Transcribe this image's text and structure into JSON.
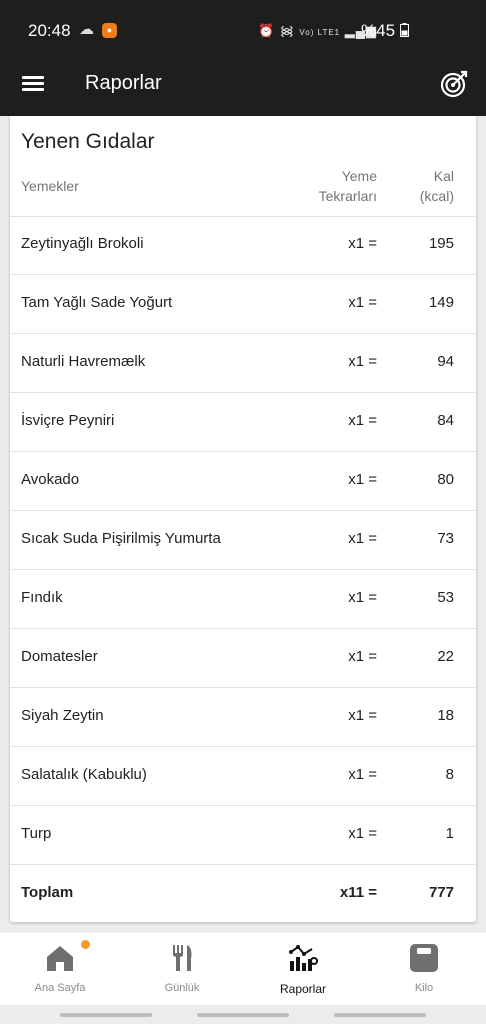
{
  "status_bar": {
    "time": "20:48",
    "battery": "%45",
    "signal_text": "Vo) LTE1"
  },
  "app_bar": {
    "title": "Raporlar"
  },
  "report": {
    "title": "Yenen Gıdalar",
    "headers": {
      "food": "Yemekler",
      "repeats_line1": "Yeme",
      "repeats_line2": "Tekrarları",
      "kcal_line1": "Kal",
      "kcal_line2": "(kcal)"
    },
    "rows": [
      {
        "name": "Zeytinyağlı Brokoli",
        "repeats": "x1 =",
        "kcal": "195"
      },
      {
        "name": "Tam Yağlı Sade Yoğurt",
        "repeats": "x1 =",
        "kcal": "149"
      },
      {
        "name": "Naturli Havremælk",
        "repeats": "x1 =",
        "kcal": "94"
      },
      {
        "name": "İsviçre Peyniri",
        "repeats": "x1 =",
        "kcal": "84"
      },
      {
        "name": "Avokado",
        "repeats": "x1 =",
        "kcal": "80"
      },
      {
        "name": "Sıcak Suda Pişirilmiş Yumurta",
        "repeats": "x1 =",
        "kcal": "73"
      },
      {
        "name": "Fındık",
        "repeats": "x1 =",
        "kcal": "53"
      },
      {
        "name": "Domatesler",
        "repeats": "x1 =",
        "kcal": "22"
      },
      {
        "name": "Siyah Zeytin",
        "repeats": "x1 =",
        "kcal": "18"
      },
      {
        "name": "Salatalık (Kabuklu)",
        "repeats": "x1 =",
        "kcal": "8"
      },
      {
        "name": "Turp",
        "repeats": "x1 =",
        "kcal": "1"
      }
    ],
    "total": {
      "name": "Toplam",
      "repeats": "x11 =",
      "kcal": "777"
    }
  },
  "bottom_nav": {
    "items": [
      {
        "label": "Ana Sayfa",
        "icon": "home-icon"
      },
      {
        "label": "Günlük",
        "icon": "fork-knife-icon"
      },
      {
        "label": "Raporlar",
        "icon": "chart-icon"
      },
      {
        "label": "Kilo",
        "icon": "scale-icon"
      }
    ],
    "active_index": 2
  },
  "colors": {
    "app_bar": "#1e1e1e",
    "background": "#ececec",
    "notification_dot": "#f59a2a"
  }
}
